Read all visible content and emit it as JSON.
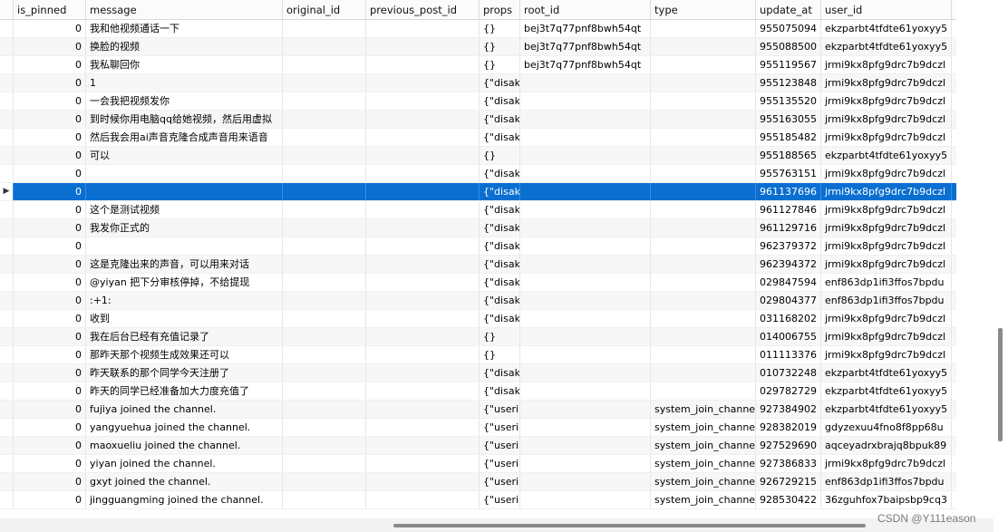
{
  "columns": {
    "is_pinned": "is_pinned",
    "message": "message",
    "original_id": "original_id",
    "previous_post_id": "previous_post_id",
    "props": "props",
    "root_id": "root_id",
    "type": "type",
    "update_at": "update_at",
    "user_id": "user_id"
  },
  "selected_indicator": "▶",
  "rows": [
    {
      "is_pinned": "0",
      "message": "我和他视频通话一下",
      "props": "{}",
      "root_id": "bej3t7q77pnf8bwh54qt",
      "type": "",
      "update_at": "955075094",
      "user_id": "ekzparbt4tfdte61yoxyy5"
    },
    {
      "is_pinned": "0",
      "message": "换脸的视频",
      "props": "{}",
      "root_id": "bej3t7q77pnf8bwh54qt",
      "type": "",
      "update_at": "955088500",
      "user_id": "ekzparbt4tfdte61yoxyy5"
    },
    {
      "is_pinned": "0",
      "message": "我私聊回你",
      "props": "{}",
      "root_id": "bej3t7q77pnf8bwh54qt",
      "type": "",
      "update_at": "955119567",
      "user_id": "jrmi9kx8pfg9drc7b9dczl"
    },
    {
      "is_pinned": "0",
      "message": "1",
      "props": "{\"disak",
      "root_id": "",
      "type": "",
      "update_at": "955123848",
      "user_id": "jrmi9kx8pfg9drc7b9dczl"
    },
    {
      "is_pinned": "0",
      "message": "一会我把视频发你",
      "props": "{\"disak",
      "root_id": "",
      "type": "",
      "update_at": "955135520",
      "user_id": "jrmi9kx8pfg9drc7b9dczl"
    },
    {
      "is_pinned": "0",
      "message": "到时候你用电脑qq给她视频，然后用虚拟",
      "props": "{\"disak",
      "root_id": "",
      "type": "",
      "update_at": "955163055",
      "user_id": "jrmi9kx8pfg9drc7b9dczl"
    },
    {
      "is_pinned": "0",
      "message": "然后我会用ai声音克隆合成声音用来语音",
      "props": "{\"disak",
      "root_id": "",
      "type": "",
      "update_at": "955185482",
      "user_id": "jrmi9kx8pfg9drc7b9dczl"
    },
    {
      "is_pinned": "0",
      "message": "可以",
      "props": "{}",
      "root_id": "",
      "type": "",
      "update_at": "955188565",
      "user_id": "ekzparbt4tfdte61yoxyy5"
    },
    {
      "is_pinned": "0",
      "message": "",
      "props": "{\"disak",
      "root_id": "",
      "type": "",
      "update_at": "955763151",
      "user_id": "jrmi9kx8pfg9drc7b9dczl"
    },
    {
      "is_pinned": "0",
      "message": "",
      "props": "{\"disak",
      "root_id": "",
      "type": "",
      "update_at": "961137696",
      "user_id": "jrmi9kx8pfg9drc7b9dczl"
    },
    {
      "is_pinned": "0",
      "message": "这个是测试视频",
      "props": "{\"disak",
      "root_id": "",
      "type": "",
      "update_at": "961127846",
      "user_id": "jrmi9kx8pfg9drc7b9dczl"
    },
    {
      "is_pinned": "0",
      "message": "我发你正式的",
      "props": "{\"disak",
      "root_id": "",
      "type": "",
      "update_at": "961129716",
      "user_id": "jrmi9kx8pfg9drc7b9dczl"
    },
    {
      "is_pinned": "0",
      "message": "",
      "props": "{\"disak",
      "root_id": "",
      "type": "",
      "update_at": "962379372",
      "user_id": "jrmi9kx8pfg9drc7b9dczl"
    },
    {
      "is_pinned": "0",
      "message": "这是克隆出来的声音，可以用来对话",
      "props": "{\"disak",
      "root_id": "",
      "type": "",
      "update_at": "962394372",
      "user_id": "jrmi9kx8pfg9drc7b9dczl"
    },
    {
      "is_pinned": "0",
      "message": "@yiyan 把下分审核停掉，不给提现",
      "props": "{\"disak",
      "root_id": "",
      "type": "",
      "update_at": "029847594",
      "user_id": "enf863dp1ifi3ffos7bpdu"
    },
    {
      "is_pinned": "0",
      "message": ":+1:",
      "props": "{\"disak",
      "root_id": "",
      "type": "",
      "update_at": "029804377",
      "user_id": "enf863dp1ifi3ffos7bpdu"
    },
    {
      "is_pinned": "0",
      "message": "收到",
      "props": "{\"disak",
      "root_id": "",
      "type": "",
      "update_at": "031168202",
      "user_id": "jrmi9kx8pfg9drc7b9dczl"
    },
    {
      "is_pinned": "0",
      "message": "我在后台已经有充值记录了",
      "props": "{}",
      "root_id": "",
      "type": "",
      "update_at": "014006755",
      "user_id": "jrmi9kx8pfg9drc7b9dczl"
    },
    {
      "is_pinned": "0",
      "message": "那昨天那个视频生成效果还可以",
      "props": "{}",
      "root_id": "",
      "type": "",
      "update_at": "011113376",
      "user_id": "jrmi9kx8pfg9drc7b9dczl"
    },
    {
      "is_pinned": "0",
      "message": "昨天联系的那个同学今天注册了",
      "props": "{\"disak",
      "root_id": "",
      "type": "",
      "update_at": "010732248",
      "user_id": "ekzparbt4tfdte61yoxyy5"
    },
    {
      "is_pinned": "0",
      "message": "昨天的同学已经准备加大力度充值了",
      "props": "{\"disak",
      "root_id": "",
      "type": "",
      "update_at": "029782729",
      "user_id": "ekzparbt4tfdte61yoxyy5"
    },
    {
      "is_pinned": "0",
      "message": "fujiya joined the channel.",
      "props": "{\"useri",
      "root_id": "",
      "type": "system_join_channe",
      "update_at": "927384902",
      "user_id": "ekzparbt4tfdte61yoxyy5"
    },
    {
      "is_pinned": "0",
      "message": "yangyuehua joined the channel.",
      "props": "{\"useri",
      "root_id": "",
      "type": "system_join_channe",
      "update_at": "928382019",
      "user_id": "gdyzexuu4fno8f8pp68u"
    },
    {
      "is_pinned": "0",
      "message": "maoxueliu joined the channel.",
      "props": "{\"useri",
      "root_id": "",
      "type": "system_join_channe",
      "update_at": "927529690",
      "user_id": "aqceyadrxbrajq8bpuk89"
    },
    {
      "is_pinned": "0",
      "message": "yiyan joined the channel.",
      "props": "{\"useri",
      "root_id": "",
      "type": "system_join_channe",
      "update_at": "927386833",
      "user_id": "jrmi9kx8pfg9drc7b9dczl"
    },
    {
      "is_pinned": "0",
      "message": "gxyt joined the channel.",
      "props": "{\"useri",
      "root_id": "",
      "type": "system_join_channe",
      "update_at": "926729215",
      "user_id": "enf863dp1ifi3ffos7bpdu"
    },
    {
      "is_pinned": "0",
      "message": "jingguangming joined the channel.",
      "props": "{\"useri",
      "root_id": "",
      "type": "system_join_channe",
      "update_at": "928530422",
      "user_id": "36zguhfox7baipsbp9cq3"
    }
  ],
  "selected_row": 9,
  "watermark": "CSDN @Y111eason",
  "colors": {
    "selection": "#0a6fd1"
  }
}
